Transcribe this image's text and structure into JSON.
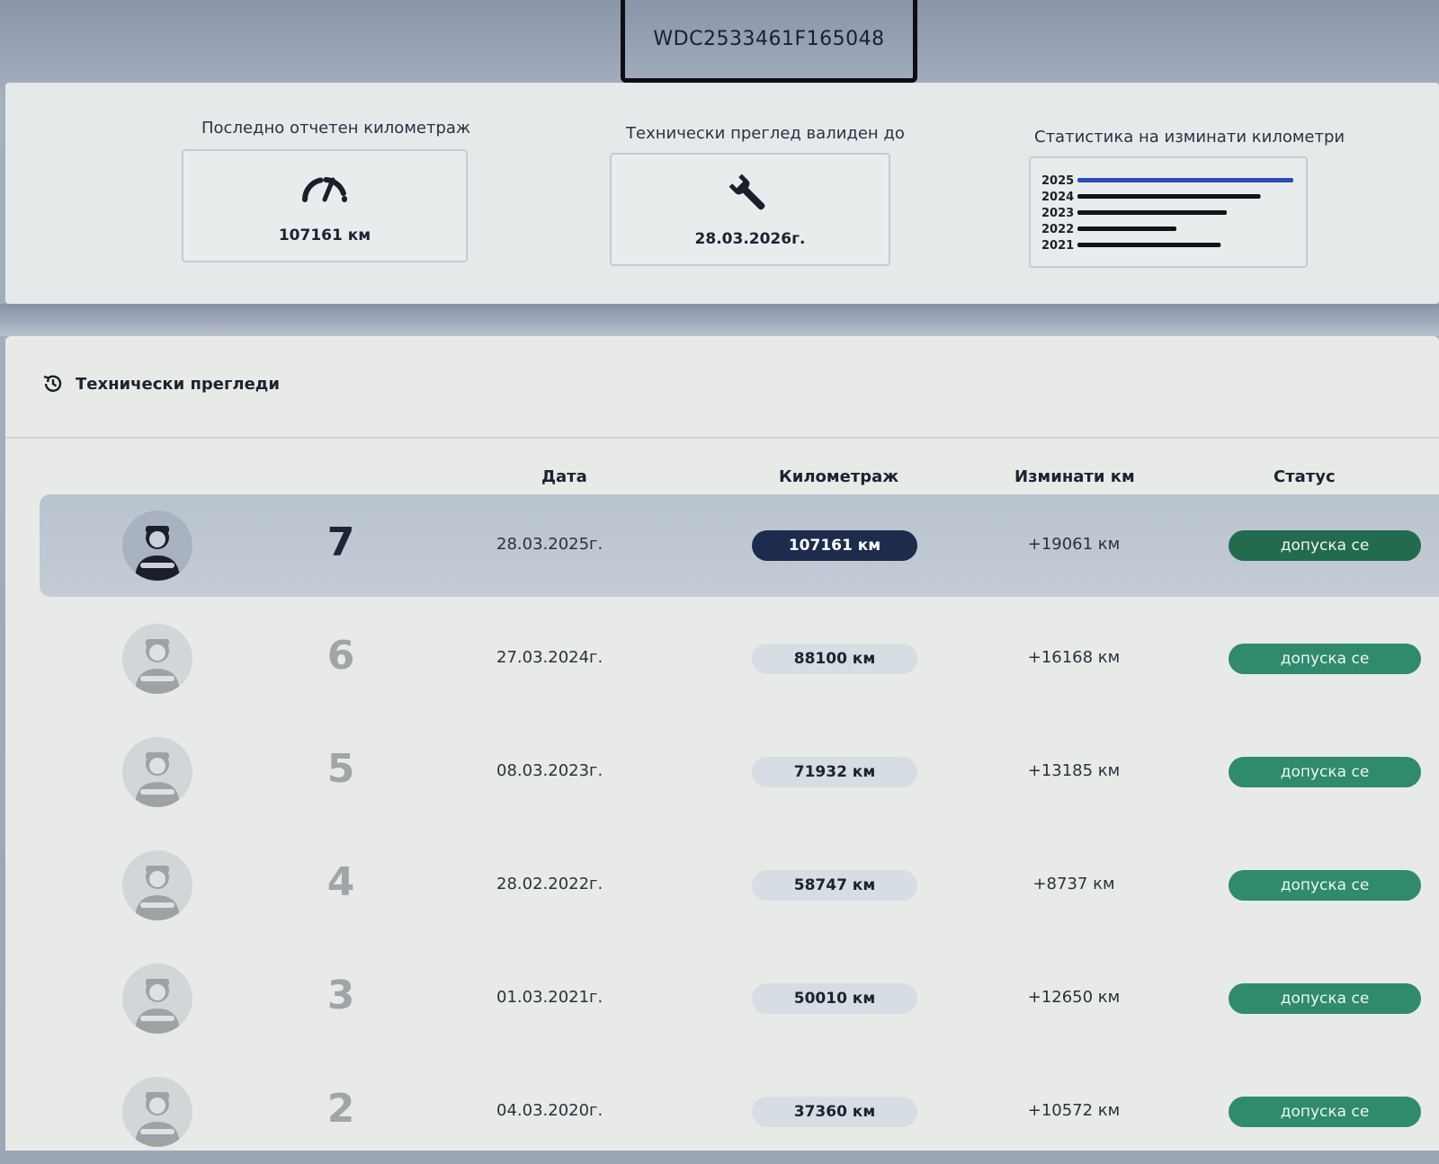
{
  "vehicle": {
    "vin": "WDC2533461F165048"
  },
  "stats": {
    "mileage_label": "Последно отчетен километраж",
    "mileage_value": "107161 км",
    "mileage_icon": "speedometer-icon",
    "inspection_label": "Технически преглед валиден до",
    "inspection_value": "28.03.2026г.",
    "inspection_icon": "wrench-icon",
    "chart_label": "Статистика на изминати километри"
  },
  "chart_data": {
    "type": "bar",
    "orientation": "horizontal",
    "categories": [
      "2025",
      "2024",
      "2023",
      "2022",
      "2021"
    ],
    "values": [
      19061,
      16168,
      13185,
      8737,
      12650
    ],
    "colors": [
      "#2c49b8",
      "#111318",
      "#111318",
      "#111318",
      "#111318"
    ],
    "grid": false
  },
  "inspections": {
    "title": "Технически прегледи",
    "title_icon": "history-icon",
    "columns": {
      "date": "Дата",
      "mileage": "Километраж",
      "driven": "Изминати км",
      "status": "Статус"
    },
    "rows": [
      {
        "num": "7",
        "date": "28.03.2025г.",
        "mileage": "107161 км",
        "driven": "+19061 км",
        "status": "допуска се"
      },
      {
        "num": "6",
        "date": "27.03.2024г.",
        "mileage": "88100 км",
        "driven": "+16168 км",
        "status": "допуска се"
      },
      {
        "num": "5",
        "date": "08.03.2023г.",
        "mileage": "71932 км",
        "driven": "+13185 км",
        "status": "допуска се"
      },
      {
        "num": "4",
        "date": "28.02.2022г.",
        "mileage": "58747 км",
        "driven": "+8737 км",
        "status": "допуска се"
      },
      {
        "num": "3",
        "date": "01.03.2021г.",
        "mileage": "50010 км",
        "driven": "+12650 км",
        "status": "допуска се"
      },
      {
        "num": "2",
        "date": "04.03.2020г.",
        "mileage": "37360 км",
        "driven": "+10572 км",
        "status": "допуска се"
      }
    ]
  },
  "colors": {
    "accent_dark": "#1d2c4d",
    "status_green": "#2f8a6e",
    "chart_highlight": "#2c49b8"
  }
}
